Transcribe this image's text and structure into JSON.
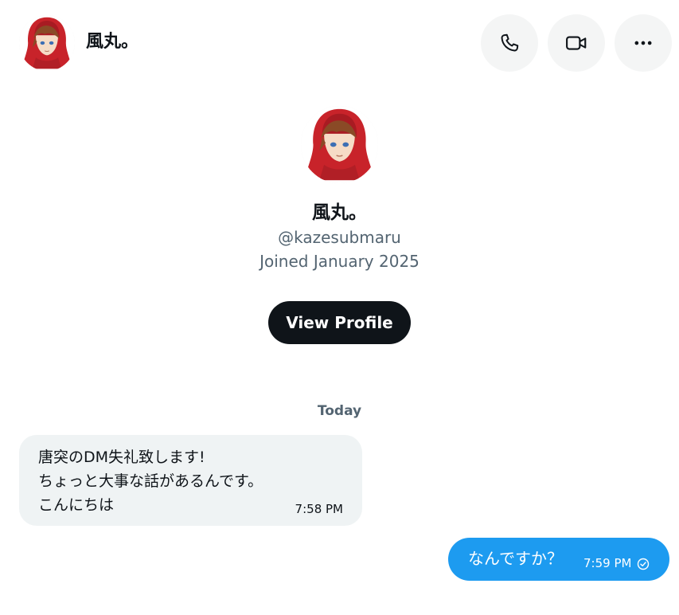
{
  "header": {
    "display_name": "風丸。",
    "avatar_icon": "avatar-red-hood-character",
    "actions": {
      "call_icon": "phone-icon",
      "video_icon": "video-camera-icon",
      "more_icon": "more-horizontal-icon"
    }
  },
  "profile": {
    "display_name": "風丸。",
    "handle": "@kazesubmaru",
    "joined": "Joined January 2025",
    "view_profile_label": "View Profile"
  },
  "conversation": {
    "date_separator": "Today",
    "messages": [
      {
        "direction": "incoming",
        "lines": [
          "唐突のDM失礼致します!",
          "ちょっと大事な話があるんです。",
          "こんにちは"
        ],
        "time": "7:58 PM"
      },
      {
        "direction": "outgoing",
        "text": "なんですか？",
        "time": "7:59 PM",
        "status_icon": "sent-check-icon"
      }
    ]
  },
  "colors": {
    "primary_text": "#0f1419",
    "secondary_text": "#536471",
    "incoming_bubble": "#eff3f4",
    "outgoing_bubble": "#1d9bf0",
    "button_dark": "#0f1419",
    "header_button_bg": "#f4f5f5",
    "hood_red": "#c8232a",
    "hair_brown": "#8a4a26"
  }
}
